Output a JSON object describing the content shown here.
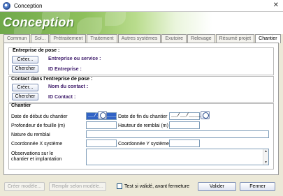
{
  "window": {
    "title": "Conception"
  },
  "banner": {
    "logo": "Conception"
  },
  "tabs": [
    "Commun",
    "Sol...",
    "Prétraitement",
    "Traitement",
    "Autres systèmes",
    "Exutoire",
    "Relevage",
    "Résumé projet",
    "Chantier"
  ],
  "active_tab": "Chantier",
  "entreprise": {
    "title": "Entreprise de pose :",
    "create_label": "Créer...",
    "search_label": "Chercher",
    "service_label": "Entreprise ou service :",
    "id_label": "ID Entreprise :"
  },
  "contact": {
    "title": "Contact dans l'entreprise de pose :",
    "create_label": "Créer...",
    "search_label": "Chercher",
    "name_label": "Nom du contact :",
    "id_label": "ID Contact :"
  },
  "chantier": {
    "title": "Chantier",
    "start_label": "Date de début du chantier",
    "start_value": "__/__/____",
    "end_label": "Date de fin du chantier",
    "end_value": "__/__/____",
    "depth_label": "Profondeur de fouille (m)",
    "fill_label": "Hauteur de remblai (m)",
    "nature_label": "Nature du remblai",
    "x_label": "Coordonnée  X système",
    "y_label": "Coordonnée Y système",
    "obs_label": "Observations sur le chantier et implantation"
  },
  "footer": {
    "create_model": "Créer modèle...",
    "fill_model": "Remplir selon modèle...",
    "checkbox_label": "Test si validé, avant fermeture",
    "validate": "Valider",
    "close": "Fermer"
  }
}
